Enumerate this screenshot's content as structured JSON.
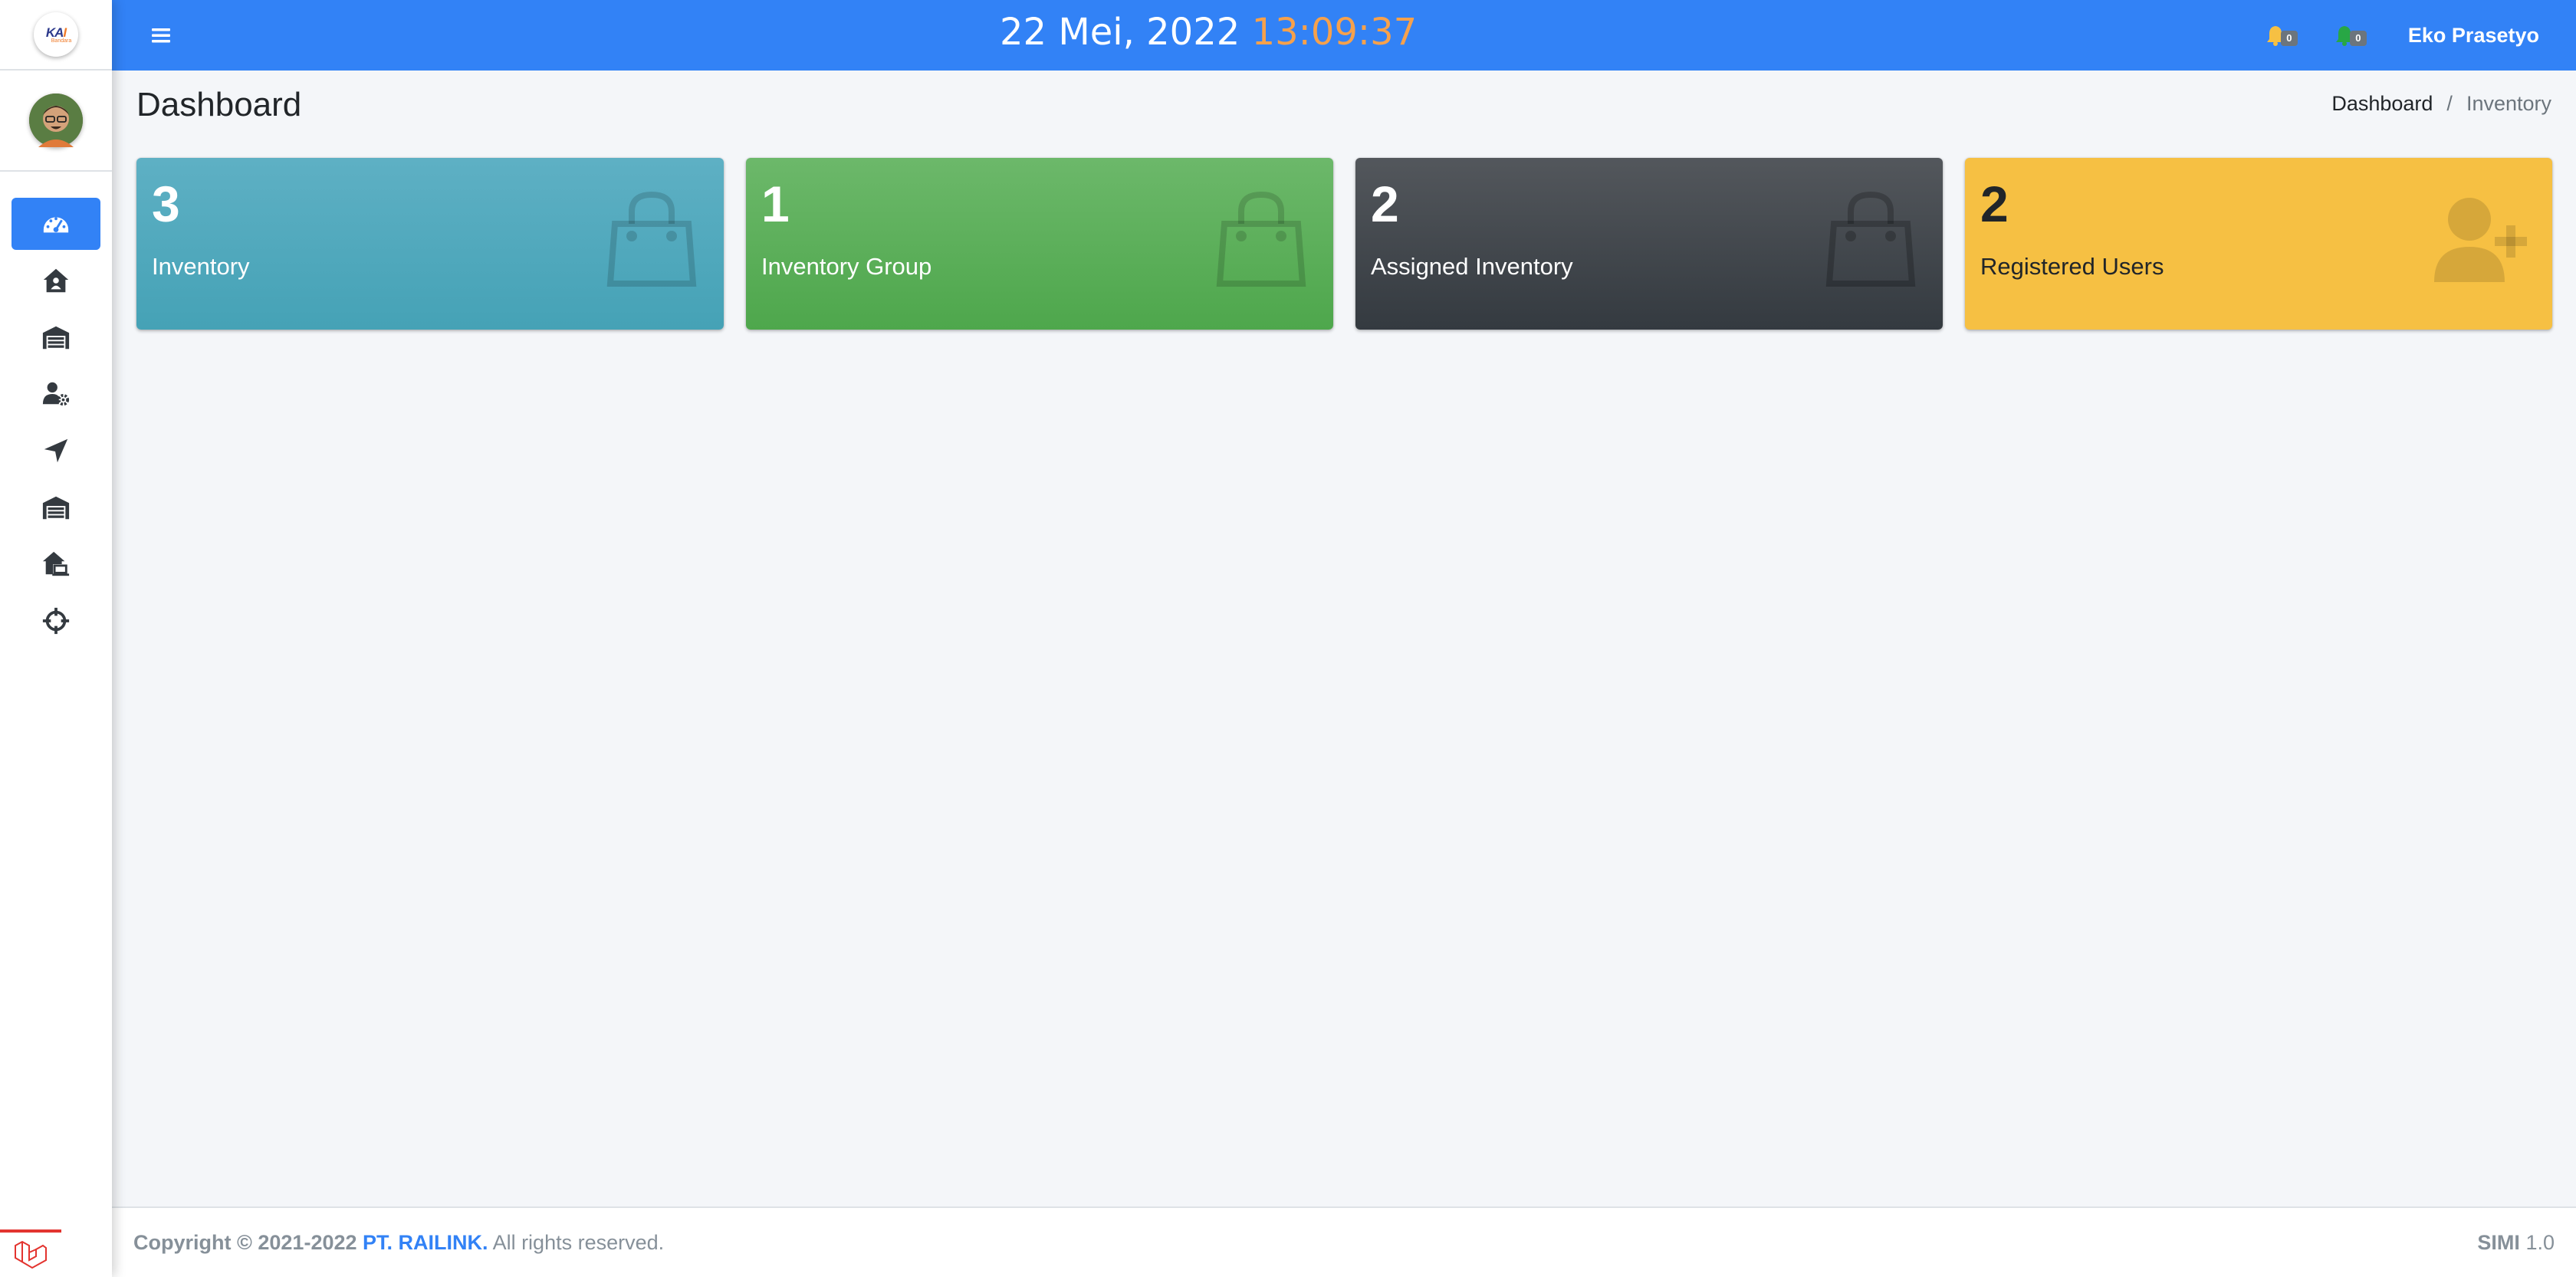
{
  "brand": {
    "logo_text_a": "KA",
    "logo_text_b": "I",
    "logo_sub": "Bandara"
  },
  "topbar": {
    "date": "22 Mei, 2022",
    "time": "13:09:37",
    "notification_count_1": "0",
    "notification_count_2": "0",
    "user_name": "Eko Prasetyo"
  },
  "header": {
    "title": "Dashboard",
    "breadcrumb": [
      {
        "label": "Dashboard"
      },
      {
        "label": "Inventory"
      }
    ],
    "breadcrumb_separator": "/"
  },
  "cards": [
    {
      "value": "3",
      "label": "Inventory",
      "icon": "shopping-bag-icon",
      "color": "#45a2b6"
    },
    {
      "value": "1",
      "label": "Inventory Group",
      "icon": "shopping-bag-icon",
      "color": "#4ea74c"
    },
    {
      "value": "2",
      "label": "Assigned Inventory",
      "icon": "shopping-bag-icon",
      "color": "#343a40"
    },
    {
      "value": "2",
      "label": "Registered Users",
      "icon": "user-plus-icon",
      "color": "#f6c043"
    }
  ],
  "sidebar": {
    "items": [
      {
        "icon": "tachometer-icon",
        "active": true
      },
      {
        "icon": "house-user-icon",
        "active": false
      },
      {
        "icon": "warehouse-icon",
        "active": false
      },
      {
        "icon": "user-cog-icon",
        "active": false
      },
      {
        "icon": "location-arrow-icon",
        "active": false
      },
      {
        "icon": "warehouse-icon",
        "active": false
      },
      {
        "icon": "house-laptop-icon",
        "active": false
      },
      {
        "icon": "crosshairs-icon",
        "active": false
      }
    ]
  },
  "footer": {
    "copyright": "Copyright © 2021-2022",
    "company": "PT. RAILINK.",
    "rights": "All rights reserved.",
    "app_name": "SIMI",
    "version": "1.0"
  },
  "colors": {
    "primary": "#3282f6",
    "time_accent": "#f6a14c",
    "bell_yellow": "#f6c043",
    "bell_green": "#28a745"
  }
}
